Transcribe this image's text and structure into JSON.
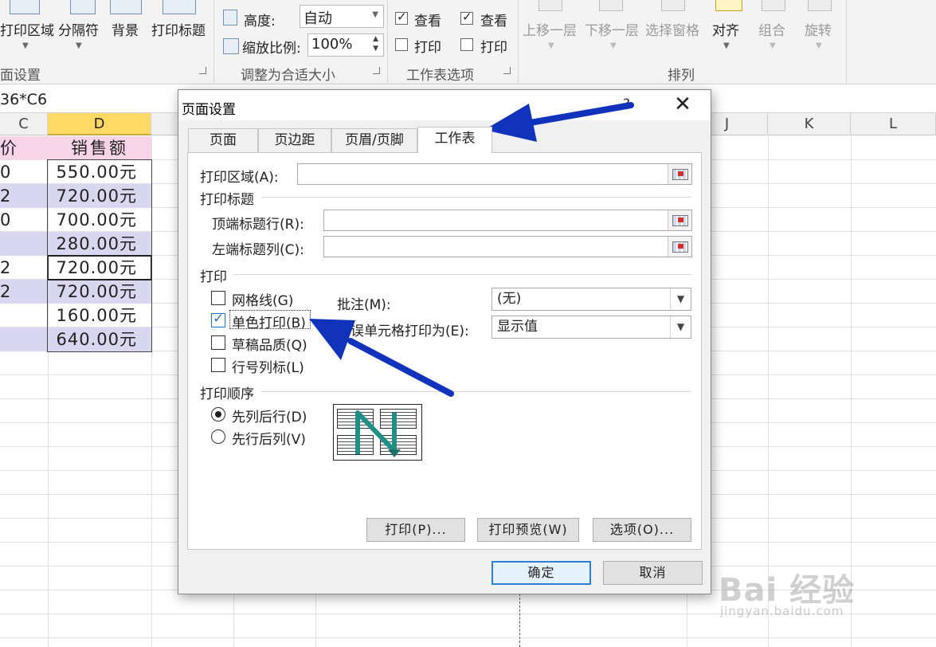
{
  "ribbon": {
    "page_setup_group": {
      "buttons": [
        "打印区域",
        "分隔符",
        "背景",
        "打印标题"
      ],
      "label": "面设置"
    },
    "scale_group": {
      "height_label": "高度:",
      "height_value": "自动",
      "scale_label": "缩放比例:",
      "scale_value": "100%",
      "label": "调整为合适大小"
    },
    "sheet_options_group": {
      "gridlines": {
        "view_label": "查看",
        "view_checked": true,
        "print_label": "打印",
        "print_checked": false
      },
      "headings": {
        "view_label": "查看",
        "view_checked": true,
        "print_label": "打印",
        "print_checked": false
      },
      "label": "工作表选项"
    },
    "arrange_group": {
      "buttons": [
        "上移一层",
        "下移一层",
        "选择窗格",
        "对齐",
        "组合",
        "旋转"
      ],
      "label": "排列"
    }
  },
  "formula_bar": {
    "text": "36*C6"
  },
  "sheet": {
    "columns": [
      {
        "name": "C",
        "selected": false
      },
      {
        "name": "D",
        "selected": true
      },
      {
        "name": "J",
        "selected": false
      },
      {
        "name": "K",
        "selected": false
      },
      {
        "name": "L",
        "selected": false
      }
    ],
    "header_row": {
      "c": "价",
      "d": "销售额"
    },
    "rows": [
      {
        "c": "0",
        "d": "550.00元",
        "band": "none"
      },
      {
        "c": "2",
        "d": "720.00元",
        "band": "purple"
      },
      {
        "c": "0",
        "d": "700.00元",
        "band": "none"
      },
      {
        "c": "",
        "d": "280.00元",
        "band": "purple"
      },
      {
        "c": "2",
        "d": "720.00元",
        "band": "none"
      },
      {
        "c": "2",
        "d": "720.00元",
        "band": "purple"
      },
      {
        "c": "",
        "d": "160.00元",
        "band": "none"
      },
      {
        "c": "",
        "d": "640.00元",
        "band": "purple"
      }
    ]
  },
  "dialog": {
    "title": "页面设置",
    "help": "?",
    "close": "✕",
    "tabs": [
      {
        "label": "页面",
        "active": false
      },
      {
        "label": "页边距",
        "active": false
      },
      {
        "label": "页眉/页脚",
        "active": false
      },
      {
        "label": "工作表",
        "active": true
      }
    ],
    "print_area_label": "打印区域(A):",
    "print_titles_section": "打印标题",
    "rows_repeat_label": "顶端标题行(R):",
    "cols_repeat_label": "左端标题列(C):",
    "print_section": "打印",
    "options": [
      {
        "label": "网格线(G)",
        "checked": false
      },
      {
        "label": "单色打印(B)",
        "checked": true
      },
      {
        "label": "草稿品质(Q)",
        "checked": false
      },
      {
        "label": "行号列标(L)",
        "checked": false
      }
    ],
    "comments_label": "批注(M):",
    "comments_value": "(无)",
    "errors_label": "错误单元格打印为(E):",
    "errors_value": "显示值",
    "page_order_section": "打印顺序",
    "order_options": [
      {
        "label": "先列后行(D)",
        "selected": true
      },
      {
        "label": "先行后列(V)",
        "selected": false
      }
    ],
    "buttons": {
      "print": "打印(P)...",
      "print_preview": "打印预览(W)",
      "options": "选项(O)...",
      "ok": "确定",
      "cancel": "取消"
    }
  },
  "annotation_color": "#1133bb",
  "watermark": {
    "logo": "Bai 经验",
    "url": "jingyan.baidu.com"
  }
}
